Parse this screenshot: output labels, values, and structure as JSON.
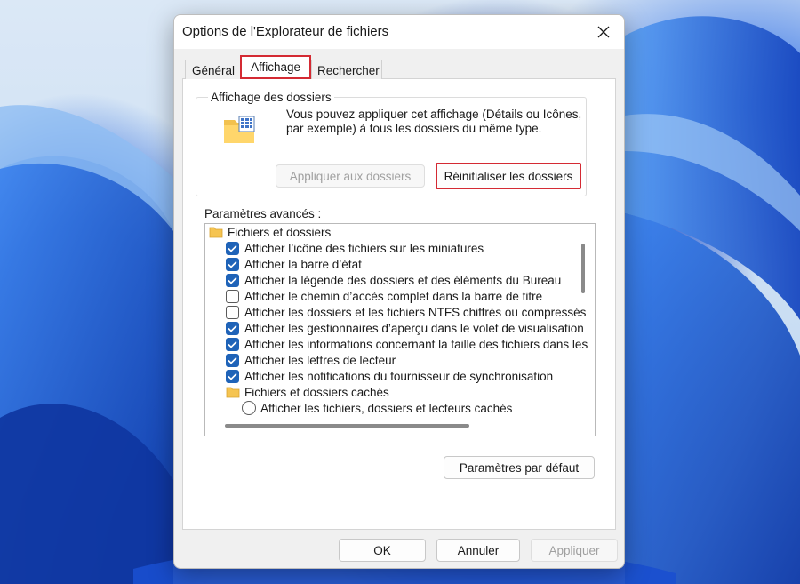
{
  "dialog": {
    "title": "Options de l'Explorateur de fichiers",
    "close_icon": "close-icon"
  },
  "tabs": [
    {
      "label": "Général",
      "selected": false
    },
    {
      "label": "Affichage",
      "selected": true
    },
    {
      "label": "Rechercher",
      "selected": false
    }
  ],
  "folder_views": {
    "legend": "Affichage des dossiers",
    "icon": "folder-view-icon",
    "description": "Vous pouvez appliquer cet affichage (Détails ou Icônes, par exemple) à tous les dossiers du même type.",
    "apply_label": "Appliquer aux dossiers",
    "reset_label": "Réinitialiser les dossiers"
  },
  "advanced": {
    "label": "Paramètres avancés :",
    "items": [
      {
        "type": "folder",
        "label": "Fichiers et dossiers"
      },
      {
        "type": "checkbox",
        "label": "Afficher l’icône des fichiers sur les miniatures",
        "checked": true
      },
      {
        "type": "checkbox",
        "label": "Afficher la barre d’état",
        "checked": true
      },
      {
        "type": "checkbox",
        "label": "Afficher la légende des dossiers et des éléments du Bureau",
        "checked": true
      },
      {
        "type": "checkbox",
        "label": "Afficher le chemin d’accès complet dans la barre de titre",
        "checked": false
      },
      {
        "type": "checkbox",
        "label": "Afficher les dossiers et les fichiers NTFS chiffrés ou compressés",
        "checked": false
      },
      {
        "type": "checkbox",
        "label": "Afficher les gestionnaires d’aperçu dans le volet de visualisation",
        "checked": true
      },
      {
        "type": "checkbox",
        "label": "Afficher les informations concernant la taille des fichiers dans les",
        "checked": true
      },
      {
        "type": "checkbox",
        "label": "Afficher les lettres de lecteur",
        "checked": true
      },
      {
        "type": "checkbox",
        "label": "Afficher les notifications du fournisseur de synchronisation",
        "checked": true
      },
      {
        "type": "subfolder",
        "label": "Fichiers et dossiers cachés"
      },
      {
        "type": "radio",
        "label": "Afficher les fichiers, dossiers et lecteurs cachés",
        "checked": false
      }
    ],
    "defaults_label": "Paramètres par défaut"
  },
  "footer": {
    "ok_label": "OK",
    "cancel_label": "Annuler",
    "apply_label": "Appliquer"
  },
  "colors": {
    "highlight": "#d42a33",
    "checkbox_accent": "#1f63b8"
  }
}
